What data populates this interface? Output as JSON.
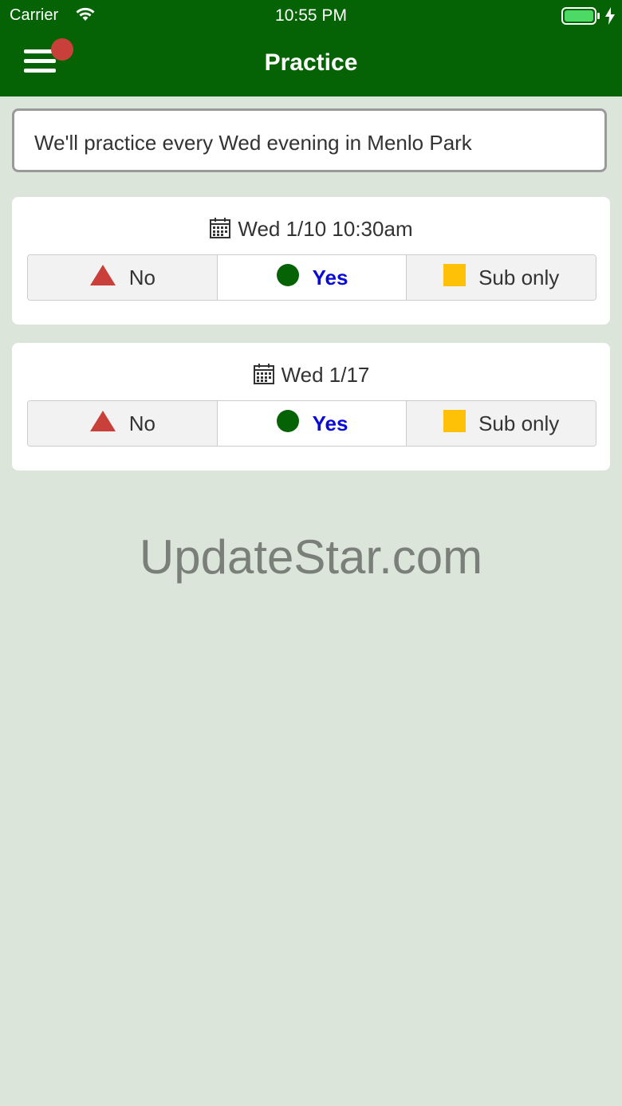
{
  "status_bar": {
    "carrier": "Carrier",
    "time": "10:55 PM"
  },
  "header": {
    "title": "Practice",
    "menu_icon": "hamburger-menu-icon",
    "badge_color": "#c9403a"
  },
  "description": "We'll practice every Wed evening in Menlo Park",
  "events": [
    {
      "date": "Wed 1/10 10:30am",
      "selected": "Yes",
      "options": [
        {
          "label": "No",
          "icon": "triangle-icon",
          "color": "#c9403a"
        },
        {
          "label": "Yes",
          "icon": "circle-icon",
          "color": "#056305"
        },
        {
          "label": "Sub only",
          "icon": "square-icon",
          "color": "#ffc107"
        }
      ]
    },
    {
      "date": "Wed 1/17",
      "selected": "Yes",
      "options": [
        {
          "label": "No",
          "icon": "triangle-icon",
          "color": "#c9403a"
        },
        {
          "label": "Yes",
          "icon": "circle-icon",
          "color": "#056305"
        },
        {
          "label": "Sub only",
          "icon": "square-icon",
          "color": "#ffc107"
        }
      ]
    }
  ],
  "watermark": "UpdateStar.com",
  "colors": {
    "header_bg": "#056305",
    "page_bg": "#dce5da",
    "selected_text": "#0a0ad6"
  }
}
